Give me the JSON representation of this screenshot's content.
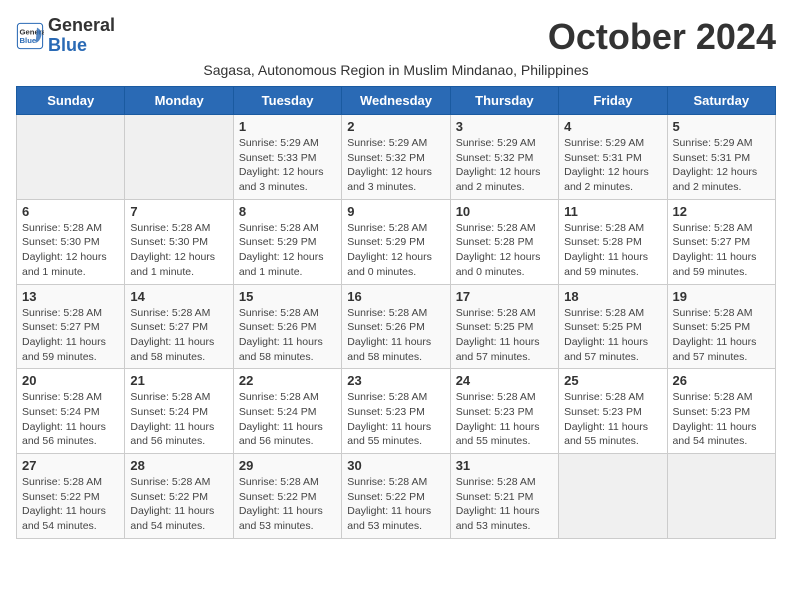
{
  "logo": {
    "line1": "General",
    "line2": "Blue"
  },
  "title": "October 2024",
  "subtitle": "Sagasa, Autonomous Region in Muslim Mindanao, Philippines",
  "days_of_week": [
    "Sunday",
    "Monday",
    "Tuesday",
    "Wednesday",
    "Thursday",
    "Friday",
    "Saturday"
  ],
  "weeks": [
    [
      {
        "day": "",
        "info": ""
      },
      {
        "day": "",
        "info": ""
      },
      {
        "day": "1",
        "info": "Sunrise: 5:29 AM\nSunset: 5:33 PM\nDaylight: 12 hours and 3 minutes."
      },
      {
        "day": "2",
        "info": "Sunrise: 5:29 AM\nSunset: 5:32 PM\nDaylight: 12 hours and 3 minutes."
      },
      {
        "day": "3",
        "info": "Sunrise: 5:29 AM\nSunset: 5:32 PM\nDaylight: 12 hours and 2 minutes."
      },
      {
        "day": "4",
        "info": "Sunrise: 5:29 AM\nSunset: 5:31 PM\nDaylight: 12 hours and 2 minutes."
      },
      {
        "day": "5",
        "info": "Sunrise: 5:29 AM\nSunset: 5:31 PM\nDaylight: 12 hours and 2 minutes."
      }
    ],
    [
      {
        "day": "6",
        "info": "Sunrise: 5:28 AM\nSunset: 5:30 PM\nDaylight: 12 hours and 1 minute."
      },
      {
        "day": "7",
        "info": "Sunrise: 5:28 AM\nSunset: 5:30 PM\nDaylight: 12 hours and 1 minute."
      },
      {
        "day": "8",
        "info": "Sunrise: 5:28 AM\nSunset: 5:29 PM\nDaylight: 12 hours and 1 minute."
      },
      {
        "day": "9",
        "info": "Sunrise: 5:28 AM\nSunset: 5:29 PM\nDaylight: 12 hours and 0 minutes."
      },
      {
        "day": "10",
        "info": "Sunrise: 5:28 AM\nSunset: 5:28 PM\nDaylight: 12 hours and 0 minutes."
      },
      {
        "day": "11",
        "info": "Sunrise: 5:28 AM\nSunset: 5:28 PM\nDaylight: 11 hours and 59 minutes."
      },
      {
        "day": "12",
        "info": "Sunrise: 5:28 AM\nSunset: 5:27 PM\nDaylight: 11 hours and 59 minutes."
      }
    ],
    [
      {
        "day": "13",
        "info": "Sunrise: 5:28 AM\nSunset: 5:27 PM\nDaylight: 11 hours and 59 minutes."
      },
      {
        "day": "14",
        "info": "Sunrise: 5:28 AM\nSunset: 5:27 PM\nDaylight: 11 hours and 58 minutes."
      },
      {
        "day": "15",
        "info": "Sunrise: 5:28 AM\nSunset: 5:26 PM\nDaylight: 11 hours and 58 minutes."
      },
      {
        "day": "16",
        "info": "Sunrise: 5:28 AM\nSunset: 5:26 PM\nDaylight: 11 hours and 58 minutes."
      },
      {
        "day": "17",
        "info": "Sunrise: 5:28 AM\nSunset: 5:25 PM\nDaylight: 11 hours and 57 minutes."
      },
      {
        "day": "18",
        "info": "Sunrise: 5:28 AM\nSunset: 5:25 PM\nDaylight: 11 hours and 57 minutes."
      },
      {
        "day": "19",
        "info": "Sunrise: 5:28 AM\nSunset: 5:25 PM\nDaylight: 11 hours and 57 minutes."
      }
    ],
    [
      {
        "day": "20",
        "info": "Sunrise: 5:28 AM\nSunset: 5:24 PM\nDaylight: 11 hours and 56 minutes."
      },
      {
        "day": "21",
        "info": "Sunrise: 5:28 AM\nSunset: 5:24 PM\nDaylight: 11 hours and 56 minutes."
      },
      {
        "day": "22",
        "info": "Sunrise: 5:28 AM\nSunset: 5:24 PM\nDaylight: 11 hours and 56 minutes."
      },
      {
        "day": "23",
        "info": "Sunrise: 5:28 AM\nSunset: 5:23 PM\nDaylight: 11 hours and 55 minutes."
      },
      {
        "day": "24",
        "info": "Sunrise: 5:28 AM\nSunset: 5:23 PM\nDaylight: 11 hours and 55 minutes."
      },
      {
        "day": "25",
        "info": "Sunrise: 5:28 AM\nSunset: 5:23 PM\nDaylight: 11 hours and 55 minutes."
      },
      {
        "day": "26",
        "info": "Sunrise: 5:28 AM\nSunset: 5:23 PM\nDaylight: 11 hours and 54 minutes."
      }
    ],
    [
      {
        "day": "27",
        "info": "Sunrise: 5:28 AM\nSunset: 5:22 PM\nDaylight: 11 hours and 54 minutes."
      },
      {
        "day": "28",
        "info": "Sunrise: 5:28 AM\nSunset: 5:22 PM\nDaylight: 11 hours and 54 minutes."
      },
      {
        "day": "29",
        "info": "Sunrise: 5:28 AM\nSunset: 5:22 PM\nDaylight: 11 hours and 53 minutes."
      },
      {
        "day": "30",
        "info": "Sunrise: 5:28 AM\nSunset: 5:22 PM\nDaylight: 11 hours and 53 minutes."
      },
      {
        "day": "31",
        "info": "Sunrise: 5:28 AM\nSunset: 5:21 PM\nDaylight: 11 hours and 53 minutes."
      },
      {
        "day": "",
        "info": ""
      },
      {
        "day": "",
        "info": ""
      }
    ]
  ]
}
